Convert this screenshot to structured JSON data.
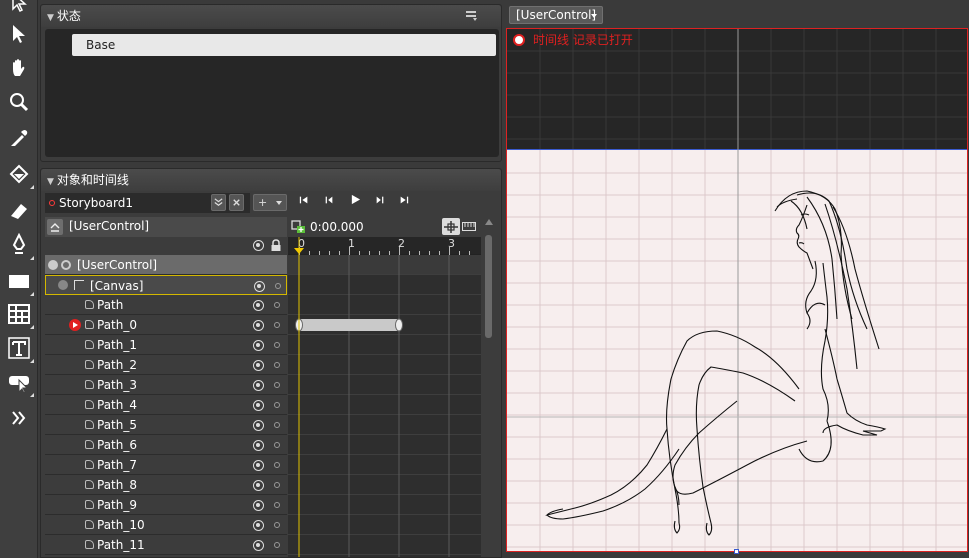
{
  "states_panel": {
    "title": "状态",
    "base_state": "Base"
  },
  "objects_panel": {
    "title": "对象和时间线",
    "storyboard": "Storyboard1",
    "scope_label": "[UserControl]",
    "add_btn": "+",
    "time": "0:00.000",
    "ruler": [
      "0",
      "1",
      "2",
      "3"
    ],
    "tree": [
      {
        "label": "[UserControl]",
        "level": 0
      },
      {
        "label": "[Canvas]",
        "level": 1
      },
      {
        "label": "Path",
        "level": 2
      },
      {
        "label": "Path_0",
        "level": 2
      },
      {
        "label": "Path_1",
        "level": 2
      },
      {
        "label": "Path_2",
        "level": 2
      },
      {
        "label": "Path_3",
        "level": 2
      },
      {
        "label": "Path_4",
        "level": 2
      },
      {
        "label": "Path_5",
        "level": 2
      },
      {
        "label": "Path_6",
        "level": 2
      },
      {
        "label": "Path_7",
        "level": 2
      },
      {
        "label": "Path_8",
        "level": 2
      },
      {
        "label": "Path_9",
        "level": 2
      },
      {
        "label": "Path_10",
        "level": 2
      },
      {
        "label": "Path_11",
        "level": 2
      }
    ]
  },
  "canvas": {
    "dropdown": "[UserControl]",
    "recording_text": "时间线 记录已打开"
  },
  "colors": {
    "record_red": "#e02020",
    "selection_yellow": "#d4b800",
    "artboard_bg": "#f7eeee"
  }
}
